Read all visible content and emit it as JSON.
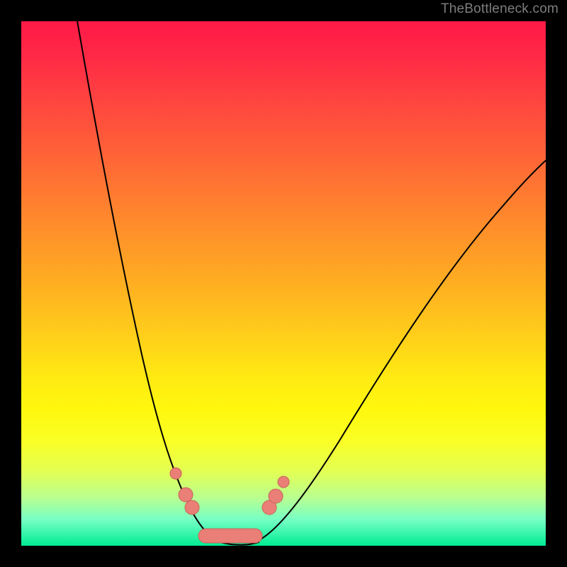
{
  "watermark": "TheBottleneck.com",
  "chart_data": {
    "type": "line",
    "title": "",
    "xlabel": "",
    "ylabel": "",
    "xlim": [
      0,
      100
    ],
    "ylim": [
      0,
      100
    ],
    "grid": false,
    "series": [
      {
        "name": "bottleneck-curve",
        "x": [
          10,
          12,
          14,
          16,
          18,
          20,
          22,
          24,
          26,
          28,
          30,
          32,
          34,
          36,
          40,
          44,
          48,
          54,
          60,
          66,
          72,
          80,
          88,
          96,
          100
        ],
        "y": [
          100,
          91,
          82,
          74,
          66,
          58,
          51,
          44,
          37,
          30,
          24,
          18,
          13,
          9,
          3,
          1,
          3,
          9,
          17,
          26,
          35,
          47,
          59,
          70,
          75
        ]
      }
    ],
    "annotations": [
      {
        "name": "marker",
        "x": 27,
        "y": 15
      },
      {
        "name": "marker",
        "x": 29,
        "y": 11
      },
      {
        "name": "marker",
        "x": 30,
        "y": 9
      },
      {
        "name": "marker",
        "x": 46,
        "y": 8
      },
      {
        "name": "marker",
        "x": 47.5,
        "y": 10
      },
      {
        "name": "marker",
        "x": 49,
        "y": 13
      },
      {
        "name": "valley-pill",
        "x_from": 32,
        "x_to": 43,
        "y": 2
      }
    ],
    "background_gradient_stops": [
      {
        "offset": 0,
        "color": "#ff1947"
      },
      {
        "offset": 50,
        "color": "#ffab22"
      },
      {
        "offset": 75,
        "color": "#fff80e"
      },
      {
        "offset": 100,
        "color": "#00ec93"
      }
    ]
  }
}
